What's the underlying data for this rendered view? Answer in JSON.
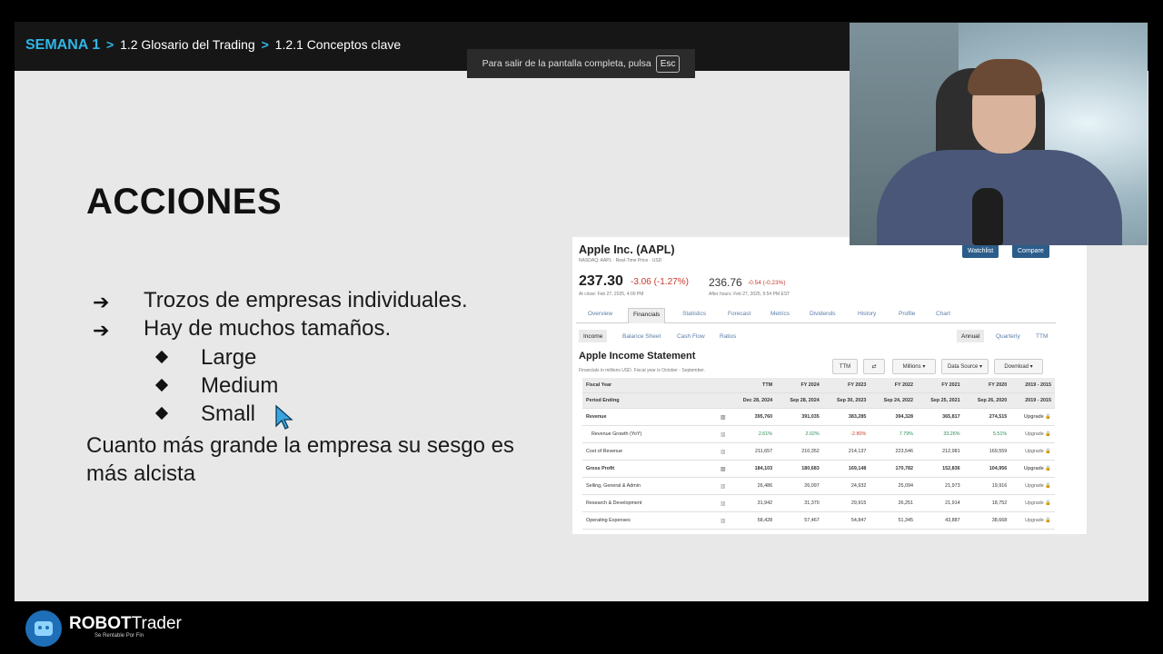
{
  "breadcrumb": {
    "week": "SEMANA 1",
    "sep": ">",
    "item1": "1.2 Glosario del Trading",
    "item2": "1.2.1  Conceptos clave"
  },
  "fullscreen_toast": {
    "text": "Para salir de la pantalla completa, pulsa",
    "key": "Esc"
  },
  "slide": {
    "title": "ACCIONES",
    "arrow_glyph": "➔",
    "bullets": [
      "Trozos de empresas individuales.",
      "Hay de muchos tamaños."
    ],
    "sub_bullets": [
      "Large",
      "Medium",
      "Small"
    ],
    "paragraph": "Cuanto más grande la empresa su sesgo es más alcista"
  },
  "financials": {
    "company": "Apple Inc. (AAPL)",
    "exchange_line": "NASDAQ: AAPL · Real-Time Price · USD",
    "watchlist": "Watchlist",
    "compare": "Compare",
    "price": "237.30",
    "change": "-3.06 (-1.27%)",
    "close_label": "At close: Feb 27, 2025, 4:00 PM",
    "after_price": "236.76",
    "after_change": "-0.54 (-0.23%)",
    "after_label": "After hours: Feb 27, 2025, 9:54 PM EST",
    "tabs": [
      "Overview",
      "Financials",
      "Statistics",
      "Forecast",
      "Metrics",
      "Dividends",
      "History",
      "Profile",
      "Chart"
    ],
    "subtabs": [
      "Income",
      "Balance Sheet",
      "Cash Flow",
      "Ratios"
    ],
    "period_tabs": [
      "Annual",
      "Quarterly",
      "TTM"
    ],
    "statement_title": "Apple Income Statement",
    "statement_note": "Financials in millions USD. Fiscal year is October - September.",
    "controls": [
      "TTM",
      "⇄",
      "Millions",
      "Data Source",
      "Download"
    ],
    "columns": [
      "Fiscal Year",
      "TTM",
      "FY 2024",
      "FY 2023",
      "FY 2022",
      "FY 2021",
      "FY 2020",
      "2019 - 2015"
    ],
    "period_row": [
      "Period Ending",
      "Dec 28, 2024",
      "Sep 28, 2024",
      "Sep 30, 2023",
      "Sep 24, 2022",
      "Sep 25, 2021",
      "Sep 26, 2020",
      "2019 - 2015"
    ],
    "rows": [
      [
        "Revenue",
        "395,760",
        "391,035",
        "383,285",
        "394,328",
        "365,817",
        "274,515",
        "Upgrade 🔒"
      ],
      [
        "Revenue Growth (YoY)",
        "2.61%",
        "2.02%",
        "-2.80%",
        "7.79%",
        "33.26%",
        "5.51%",
        "Upgrade 🔒"
      ],
      [
        "Cost of Revenue",
        "211,657",
        "210,352",
        "214,137",
        "223,546",
        "212,981",
        "169,559",
        "Upgrade 🔒"
      ],
      [
        "Gross Profit",
        "184,103",
        "180,683",
        "169,148",
        "170,782",
        "152,836",
        "104,956",
        "Upgrade 🔒"
      ],
      [
        "Selling, General & Admin",
        "26,486",
        "26,097",
        "24,932",
        "25,094",
        "21,973",
        "19,916",
        "Upgrade 🔒"
      ],
      [
        "Research & Development",
        "31,942",
        "31,370",
        "29,915",
        "26,251",
        "21,914",
        "18,752",
        "Upgrade 🔒"
      ],
      [
        "Operating Expenses",
        "58,428",
        "57,467",
        "54,847",
        "51,345",
        "43,887",
        "38,668",
        "Upgrade 🔒"
      ]
    ]
  },
  "footer": {
    "brand_bold": "ROBOT",
    "brand_light": "rader",
    "tagline": "Se Rentable Por Fin"
  }
}
